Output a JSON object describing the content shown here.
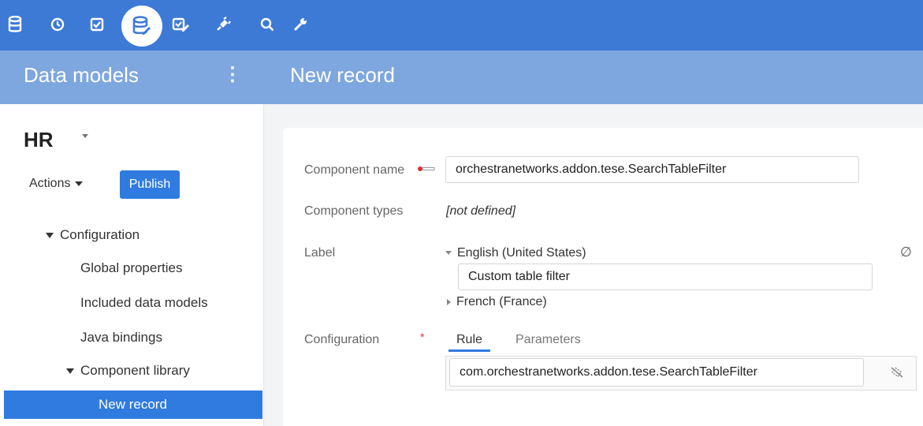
{
  "toolbar": {
    "icons": [
      "database-icon",
      "clock-icon",
      "checkbox-icon",
      "data-model-icon",
      "checklist-edit-icon",
      "plugin-icon",
      "search-icon",
      "wrench-icon"
    ],
    "active_icon": "data-model-icon",
    "color": "#3d7ad6"
  },
  "header": {
    "left_title": "Data models",
    "menu_glyph": "⋮",
    "right_title": "New record",
    "color": "#7ea7df"
  },
  "sidebar": {
    "model_name": "HR",
    "actions_label": "Actions",
    "publish_label": "Publish",
    "tree": {
      "configuration": "Configuration",
      "global_properties": "Global properties",
      "included_data_models": "Included data models",
      "java_bindings": "Java bindings",
      "component_library": "Component library",
      "new_record": "New record"
    },
    "selected_color": "#2f7be0"
  },
  "form": {
    "component_name_label": "Component name",
    "component_name_value": "orchestranetworks.addon.tese.SearchTableFilter",
    "component_types_label": "Component types",
    "component_types_value": "[not defined]",
    "label_label": "Label",
    "lang_english": "English (United States)",
    "english_value": "Custom table filter",
    "lang_french": "French (France)",
    "null_glyph": "∅",
    "configuration_label": "Configuration",
    "required_mark": "*",
    "tab_rule": "Rule",
    "tab_parameters": "Parameters",
    "rule_value": "com.orchestranetworks.addon.tese.SearchTableFilter"
  }
}
